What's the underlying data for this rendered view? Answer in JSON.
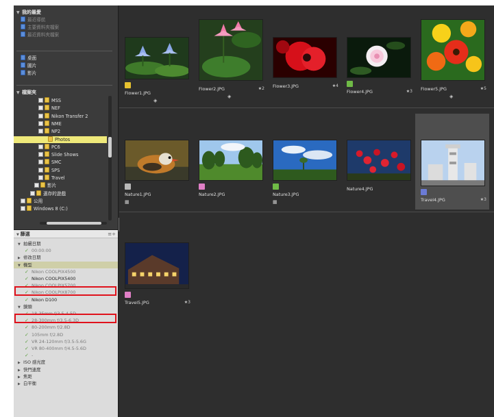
{
  "left_panel": {
    "favorites": {
      "title": "我的最愛",
      "items": [
        {
          "label": "最近導航",
          "dim": true
        },
        {
          "label": "主要資料夾檔案",
          "dim": true
        },
        {
          "label": "最近資料夾檔案",
          "dim": true
        }
      ],
      "places": [
        {
          "label": "桌面"
        },
        {
          "label": "圖片"
        },
        {
          "label": "影片"
        }
      ]
    },
    "folders": {
      "title": "檔案夾",
      "items": [
        {
          "label": "MSS",
          "indent": 36
        },
        {
          "label": "NEF",
          "indent": 36
        },
        {
          "label": "Nikon Transfer 2",
          "indent": 36
        },
        {
          "label": "NME",
          "indent": 36
        },
        {
          "label": "NP2",
          "indent": 36
        },
        {
          "label": "Photos",
          "indent": 50,
          "selected": true
        },
        {
          "label": "PC6",
          "indent": 36
        },
        {
          "label": "Slide Shows",
          "indent": 36
        },
        {
          "label": "SMC",
          "indent": 36
        },
        {
          "label": "SPS",
          "indent": 36
        },
        {
          "label": "Travel",
          "indent": 36
        },
        {
          "label": "影片",
          "indent": 30
        },
        {
          "label": "選存的遊戲",
          "indent": 24
        },
        {
          "label": "公用",
          "indent": 10
        },
        {
          "label": "Windows 8 (C:)",
          "indent": 10
        }
      ]
    },
    "filter": {
      "title": "篩選",
      "bar_icon": "≡+",
      "rows": [
        {
          "kind": "cat",
          "tri": "▼",
          "label": "拍攝日期"
        },
        {
          "kind": "item",
          "label": "00:00:00"
        },
        {
          "kind": "cat",
          "tri": "▶",
          "label": "修改日期"
        },
        {
          "kind": "cat",
          "tri": "▼",
          "label": "機型",
          "hl": true
        },
        {
          "kind": "item",
          "label": "Nikon COOLPIX4500"
        },
        {
          "kind": "item",
          "label": "Nikon COOLPIX5400",
          "sel": true
        },
        {
          "kind": "item",
          "label": "Nikon COOLPIX5700"
        },
        {
          "kind": "item",
          "label": "Nikon COOLPIX8700"
        },
        {
          "kind": "item",
          "label": "Nikon D100",
          "sel": true
        },
        {
          "kind": "cat",
          "tri": "▼",
          "label": "鏡頭"
        },
        {
          "kind": "item",
          "label": "18-35mm f/3.5-4.5D"
        },
        {
          "kind": "item",
          "label": "28-300mm f/3.5-6.3D"
        },
        {
          "kind": "item",
          "label": "80-200mm f/2.8D"
        },
        {
          "kind": "item",
          "label": "105mm f/2.8D"
        },
        {
          "kind": "item",
          "label": "VR 24-120mm f/3.5-5.6G"
        },
        {
          "kind": "item",
          "label": "VR 80-400mm f/4.5-5.6D"
        },
        {
          "kind": "item",
          "label": "-"
        },
        {
          "kind": "cat",
          "tri": "▶",
          "label": "ISO 感光度"
        },
        {
          "kind": "cat",
          "tri": "▶",
          "label": "快門速度"
        },
        {
          "kind": "cat",
          "tri": "▶",
          "label": "焦距"
        },
        {
          "kind": "cat",
          "tri": "▶",
          "label": "白平衡"
        }
      ]
    }
  },
  "thumbnails": [
    {
      "name": "Flower1.JPG",
      "badge": "yellow",
      "rating": "",
      "sub": "◈",
      "art": "lotus",
      "row": 0,
      "col": 0
    },
    {
      "name": "Flower2.JPG",
      "badge": "",
      "rating": "★2",
      "sub": "◈",
      "art": "pinklotus",
      "row": 0,
      "col": 1
    },
    {
      "name": "Flower3.JPG",
      "badge": "",
      "rating": "★4",
      "sub": "",
      "art": "poppy",
      "row": 0,
      "col": 2
    },
    {
      "name": "Flower4.JPG",
      "badge": "green",
      "rating": "★3",
      "sub": "",
      "art": "rose",
      "row": 0,
      "col": 3
    },
    {
      "name": "Flower5.JPG",
      "badge": "",
      "rating": "★5",
      "sub": "◈",
      "art": "poppies",
      "row": 0,
      "col": 4
    },
    {
      "name": "Nature1.JPG",
      "badge": "gray",
      "rating": "",
      "sub": "▦",
      "art": "duck",
      "row": 1,
      "col": 0
    },
    {
      "name": "Nature2.JPG",
      "badge": "pink",
      "rating": "",
      "sub": "",
      "art": "field",
      "row": 1,
      "col": 1
    },
    {
      "name": "Nature3.JPG",
      "badge": "green",
      "rating": "",
      "sub": "▦",
      "art": "sky",
      "row": 1,
      "col": 2
    },
    {
      "name": "Nature4.JPG",
      "badge": "",
      "rating": "",
      "sub": "",
      "art": "berries",
      "row": 1,
      "col": 3
    },
    {
      "name": "Travel4.JPG",
      "badge": "purple",
      "rating": "★3",
      "sub": "",
      "art": "lighthouse",
      "row": 1,
      "col": 4,
      "selected": true
    },
    {
      "name": "Travel5.JPG",
      "badge": "pink",
      "rating": "★3",
      "sub": "",
      "art": "nightbuilding",
      "row": 2,
      "col": 0
    }
  ]
}
